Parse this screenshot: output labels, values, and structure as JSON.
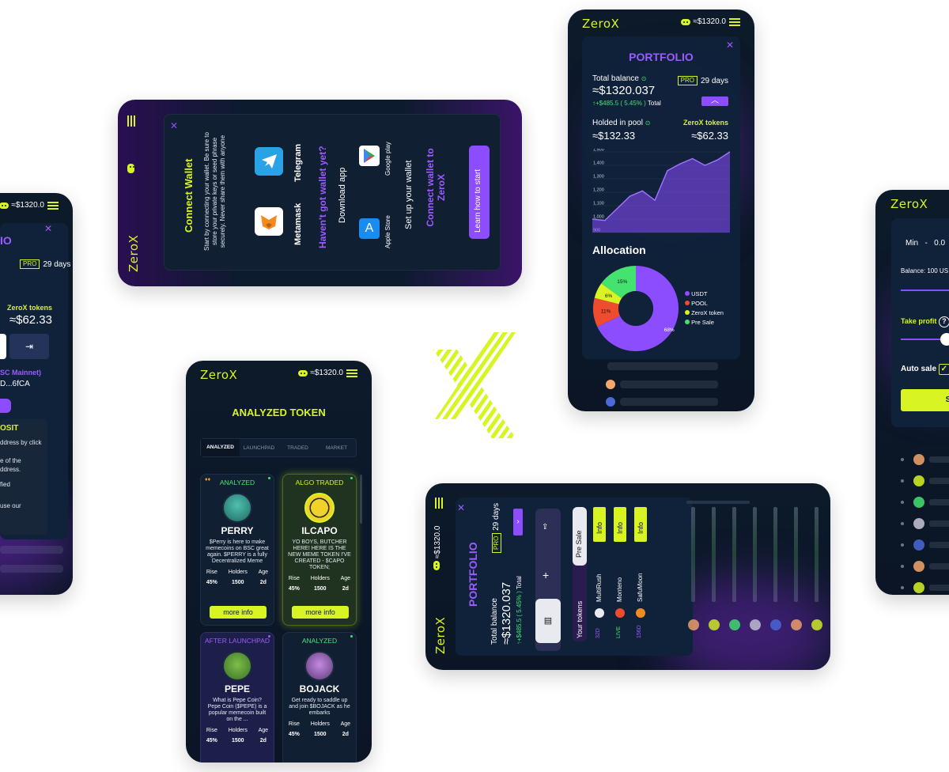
{
  "brand": {
    "logo": "ZeroX",
    "balance_chip": "≈$1320.0",
    "balance_chip_short": "≈$1320.0"
  },
  "left_phone": {
    "title": "IO",
    "pro": "PRO",
    "days": "29 days",
    "zerox_tokens": "ZeroX tokens",
    "zerox_value": "≈$62.33",
    "network": "SC Mainnet)",
    "address": "D...6fCA",
    "deposit_title": "OSIT",
    "deposit_lines": [
      "ddress by click",
      "e of the",
      "ddress.",
      "fied",
      "use our"
    ]
  },
  "connect_wallet": {
    "title": "Connect Wallet",
    "intro": "Start by connecting your wallet. Be sure to store your private keys or seed phrase securely. Never share them with anyone",
    "telegram": "Telegram",
    "metamask": "Metamask",
    "havent": "Haven't got wallet yet?",
    "download": "Download app",
    "google_play": "Google play",
    "app_store": "Apple Store",
    "setup": "Set up your wallet",
    "connect_to": "Connect wallet to ZeroX",
    "learn": "Learn how to start",
    "logo": "ZeroX"
  },
  "portfolio": {
    "title": "PORTFOLIO",
    "total_balance_label": "Total balance",
    "pro": "PRO",
    "days": "29 days",
    "total_value": "≈$1320.037",
    "change": "↑+$485.5 ( 5.45% )",
    "total": "Total",
    "pool_label": "Holded in pool",
    "pool_value": "≈$132.33",
    "zerox_label": "ZeroX tokens",
    "zerox_value": "≈$62.33",
    "y_ticks": [
      "1,500",
      "1,400",
      "1,300",
      "1,200",
      "1,100",
      "1,000",
      "900"
    ],
    "allocation_title": "Allocation",
    "legend": [
      "USDT",
      "POOL",
      "ZeroX token",
      "Pre Sale"
    ]
  },
  "chart_data": [
    {
      "type": "area",
      "title": "",
      "x": [
        1,
        2,
        3,
        4,
        5,
        6,
        7,
        8,
        9,
        10,
        11,
        12
      ],
      "values": [
        1000,
        990,
        1080,
        1170,
        1210,
        1140,
        1360,
        1410,
        1450,
        1400,
        1440,
        1500
      ],
      "ylim": [
        900,
        1500
      ],
      "yticks": [
        "1,500",
        "1,400",
        "1,300",
        "1,200",
        "1,100",
        "1,000",
        "900"
      ],
      "color": "#8b4dff"
    },
    {
      "type": "pie",
      "title": "Allocation",
      "labels": [
        "USDT",
        "POOL",
        "ZeroX token",
        "Pre Sale"
      ],
      "values": [
        68,
        11,
        6,
        15
      ],
      "colors": [
        "#8b4dff",
        "#ef4b2f",
        "#d8f423",
        "#44e36f"
      ]
    }
  ],
  "analyzed": {
    "title": "ANALYZED TOKEN",
    "tabs": [
      "ANALYZED",
      "LAUNCHPAD",
      "TRADED",
      "MARKET"
    ],
    "cards": [
      {
        "tag": "ANALYZED",
        "name": "PERRY",
        "desc": "$Perry is here to make memecoins on BSC great again. $PERRY is a fully Decentralized Meme",
        "rise": "45%",
        "holders": "1500",
        "age": "2d",
        "btn": "more info"
      },
      {
        "tag": "ALGO TRADED",
        "name": "ILCAPO",
        "desc": "YO BOYS, BUTCHER HERE! HERE IS THE NEW MEME TOKEN I'VE CREATED - $CAPO TOKEN;",
        "rise": "45%",
        "holders": "1500",
        "age": "2d",
        "btn": "more info"
      },
      {
        "tag": "AFTER LAUNCHPAD",
        "name": "PEPE",
        "desc": "What is Pepe Coin? Pepe Coin ($PEPE) is a popular memecoin built on the ...",
        "rise": "45%",
        "holders": "1500",
        "age": "2d"
      },
      {
        "tag": "ANALYZED",
        "name": "BOJACK",
        "desc": "Get ready to saddle up and join $BOJACK as he embarks",
        "rise": "45%",
        "holders": "1500",
        "age": "2d"
      }
    ],
    "labels": {
      "rise": "Rise",
      "holders": "Holders",
      "age": "Age"
    }
  },
  "landscape": {
    "title": "PORTFOLIO",
    "total_label": "Total balance",
    "value": "≈$1320.037",
    "change": "↑+$485.5 ( 5.45% )",
    "total": "Total",
    "pro": "PRO",
    "days": "29 days",
    "your_tokens": "Your tokens",
    "pre_sale": "Pre Sale",
    "tokens": [
      {
        "name": "MultiRush",
        "status": "32D",
        "btn": "Info"
      },
      {
        "name": "Monteno",
        "status": "LIVE",
        "btn": "Info"
      },
      {
        "name": "SafuMoon",
        "status": "156D",
        "btn": "Info"
      }
    ],
    "logo": "ZeroX",
    "balance": "≈$1320.0"
  },
  "right_phone": {
    "logo": "ZeroX",
    "min": "Min",
    "dash": "-",
    "min_val": "0.0",
    "balance": "Balance: 100 US",
    "take_profit": "Take profit",
    "auto_sale": "Auto sale",
    "save": "S"
  }
}
